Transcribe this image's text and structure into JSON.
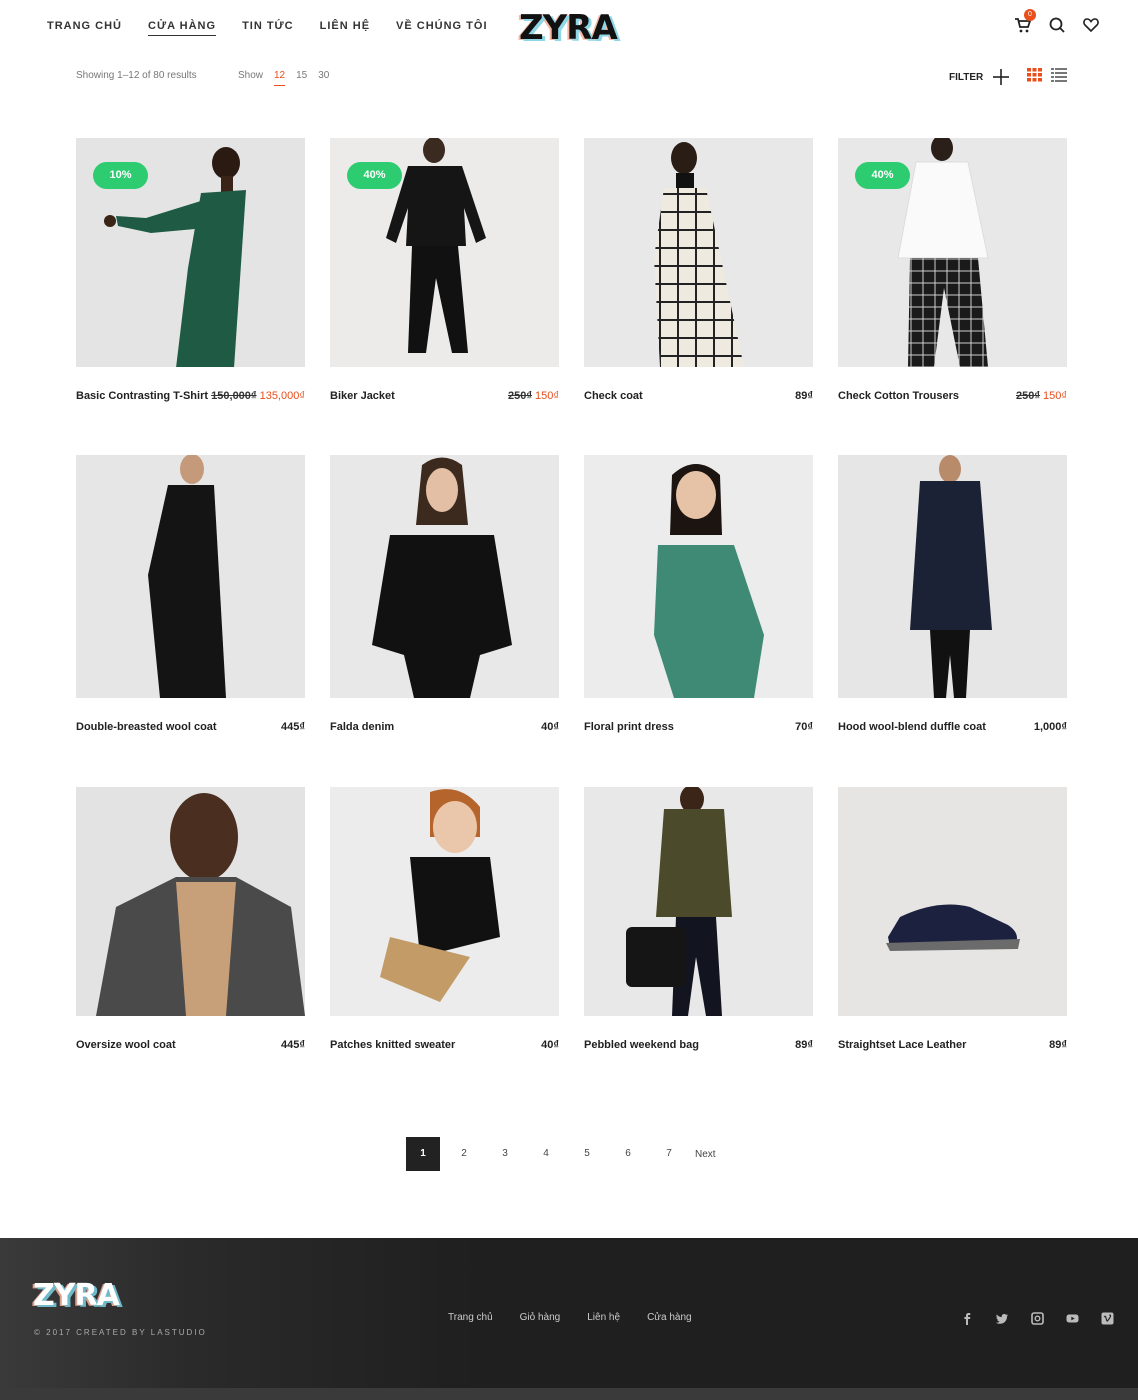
{
  "header": {
    "nav": [
      "TRANG CHỦ",
      "CỬA HÀNG",
      "TIN TỨC",
      "LIÊN HỆ",
      "VỀ CHÚNG TÔI"
    ],
    "active_nav": "CỬA HÀNG",
    "logo": "ZYRA",
    "cart_count": "0",
    "icons": [
      "cart-icon",
      "search-icon",
      "heart-icon"
    ]
  },
  "toolbar": {
    "result_count": "Showing 1–12 of 80 results",
    "show_label": "Show",
    "per_page": [
      "12",
      "15",
      "30"
    ],
    "per_page_selected": "12",
    "filter_label": "FILTER"
  },
  "products": [
    {
      "name": "Basic Contrasting T-Shirt",
      "old_price": "150,000₫",
      "price": "135,000₫",
      "badge": "10%"
    },
    {
      "name": "Biker Jacket",
      "old_price": "250₫",
      "price": "150₫",
      "badge": "40%"
    },
    {
      "name": "Check coat",
      "old_price": "",
      "price": "89₫",
      "badge": ""
    },
    {
      "name": "Check Cotton Trousers",
      "old_price": "250₫",
      "price": "150₫",
      "badge": "40%"
    },
    {
      "name": "Double-breasted wool coat",
      "old_price": "",
      "price": "445₫",
      "badge": ""
    },
    {
      "name": "Falda denim",
      "old_price": "",
      "price": "40₫",
      "badge": ""
    },
    {
      "name": "Floral print dress",
      "old_price": "",
      "price": "70₫",
      "badge": ""
    },
    {
      "name": "Hood wool-blend duffle coat",
      "old_price": "",
      "price": "1,000₫",
      "badge": ""
    },
    {
      "name": "Oversize wool coat",
      "old_price": "",
      "price": "445₫",
      "badge": ""
    },
    {
      "name": "Patches knitted sweater",
      "old_price": "",
      "price": "40₫",
      "badge": ""
    },
    {
      "name": "Pebbled weekend bag",
      "old_price": "",
      "price": "89₫",
      "badge": ""
    },
    {
      "name": "Straightset Lace Leather",
      "old_price": "",
      "price": "89₫",
      "badge": ""
    }
  ],
  "pagination": {
    "pages": [
      "1",
      "2",
      "3",
      "4",
      "5",
      "6",
      "7"
    ],
    "current": "1",
    "next": "Next"
  },
  "footer": {
    "logo": "ZYRA",
    "copyright": "© 2017 CREATED BY LASTUDIO",
    "nav": [
      "Trang chủ",
      "Giỏ hàng",
      "Liên hệ",
      "Cửa hàng"
    ],
    "socials": [
      "facebook-icon",
      "twitter-icon",
      "instagram-icon",
      "youtube-icon",
      "vimeo-icon"
    ]
  },
  "colors": {
    "accent": "#e94e1b",
    "badge": "#2ecc71",
    "footer_bg": "#1f1f1f"
  }
}
